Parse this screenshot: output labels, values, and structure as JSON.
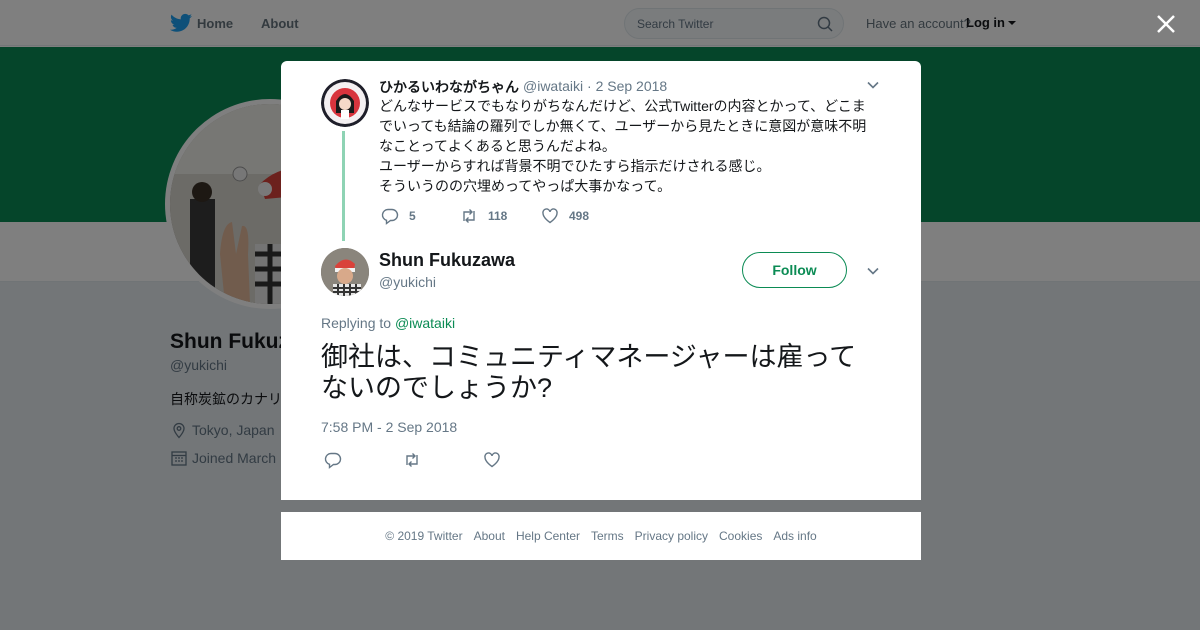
{
  "nav": {
    "home_label": "Home",
    "about_label": "About",
    "search_placeholder": "Search Twitter",
    "account_question": "Have an account?",
    "login_label": "Log in"
  },
  "profile": {
    "name": "Shun Fukuz",
    "handle": "@yukichi",
    "bio": "自称炭鉱のカナリ",
    "location": "Tokyo, Japan",
    "joined": "Joined March"
  },
  "parent_tweet": {
    "author_name": "ひかるいわながちゃん",
    "author_handle": "@iwataiki",
    "date": "· 2 Sep 2018",
    "text_lines": [
      "どんなサービスでもなりがちなんだけど、公式Twitterの内容とかって、どこま",
      "でいっても結論の羅列でしか無くて、ユーザーから見たときに意図が意味不明",
      "なことってよくあると思うんだよね。",
      "ユーザーからすれば背景不明でひたすら指示だけされる感じ。",
      "そういうのの穴埋めってやっぱ大事かなって。"
    ],
    "reply_count": "5",
    "retweet_count": "118",
    "like_count": "498"
  },
  "main_tweet": {
    "author_name": "Shun Fukuzawa",
    "author_handle": "@yukichi",
    "follow_label": "Follow",
    "replying_prefix": "Replying to ",
    "replying_to": "@iwataiki",
    "text_lines": [
      "御社は、コミュニティマネージャーは雇って",
      "ないのでしょうか?"
    ],
    "timestamp": "7:58 PM - 2 Sep 2018"
  },
  "footer": {
    "links": [
      "© 2019 Twitter",
      "About",
      "Help Center",
      "Terms",
      "Privacy policy",
      "Cookies",
      "Ads info"
    ]
  },
  "colors": {
    "accent": "#0b8b54",
    "banner": "#0b8b54",
    "thread_line": "#8ed3b4",
    "secondary_text": "#657786"
  },
  "icons": [
    "twitter-bird-icon",
    "search-icon",
    "close-icon",
    "chevron-down-icon",
    "reply-icon",
    "retweet-icon",
    "like-icon",
    "location-icon",
    "calendar-icon"
  ]
}
